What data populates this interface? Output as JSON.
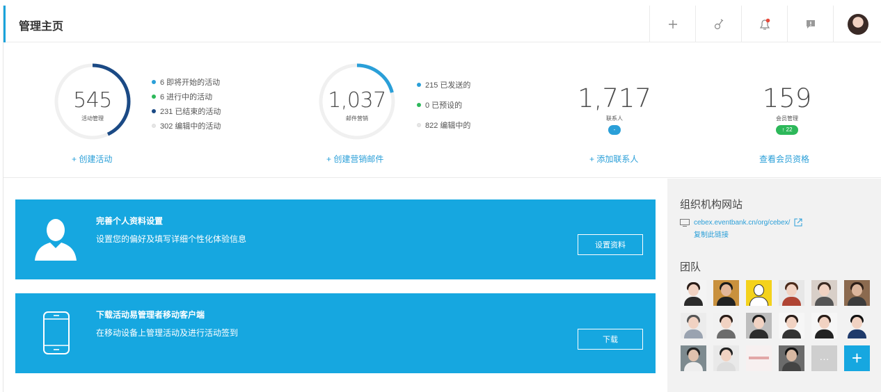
{
  "header": {
    "title": "管理主页",
    "actions": [
      "plus-icon",
      "pin-icon",
      "bell-icon",
      "message-icon",
      "user-avatar"
    ]
  },
  "stats": {
    "events": {
      "value": "545",
      "caption": "活动管理",
      "legend": [
        {
          "text": "6 即将开始的活动",
          "color": "#2a9fd8"
        },
        {
          "text": "6 进行中的活动",
          "color": "#2db85a"
        },
        {
          "text": "231 已结束的活动",
          "color": "#1b4a85"
        },
        {
          "text": "302 编辑中的活动",
          "color": "#e6e6e6"
        }
      ],
      "link": "+ 创建活动",
      "ring_fraction": 0.43
    },
    "emails": {
      "value": "1,037",
      "caption": "邮件营销",
      "legend": [
        {
          "text": "215 已发送的",
          "color": "#2a9fd8"
        },
        {
          "text": "0 已预设的",
          "color": "#2db85a"
        },
        {
          "text": "822 编辑中的",
          "color": "#e6e6e6"
        }
      ],
      "link": "+ 创建营销邮件",
      "ring_fraction": 0.21
    },
    "contacts": {
      "value": "1,717",
      "caption": "联系人",
      "badge": "-",
      "link": "+ 添加联系人"
    },
    "members": {
      "value": "159",
      "caption": "会员管理",
      "badge": "↑ 22",
      "link": "查看会员资格"
    }
  },
  "banners": [
    {
      "title": "完善个人资料设置",
      "desc": "设置您的偏好及填写详细个性化体验信息",
      "button": "设置资料",
      "icon": "user-silhouette-icon"
    },
    {
      "title": "下载活动易管理者移动客户端",
      "desc": "在移动设备上管理活动及进行活动签到",
      "button": "下载",
      "icon": "mobile-phone-icon"
    }
  ],
  "sidebar": {
    "site_title": "组织机构网站",
    "url": "cebex.eventbank.cn/org/cebex/",
    "copy_link": "复制此链接",
    "team_title": "团队",
    "more_label": "···",
    "add_label": "+"
  },
  "colors": {
    "accent": "#16a7e0",
    "link": "#2a9fd8",
    "green": "#2db85a",
    "navy": "#1b4a85"
  }
}
